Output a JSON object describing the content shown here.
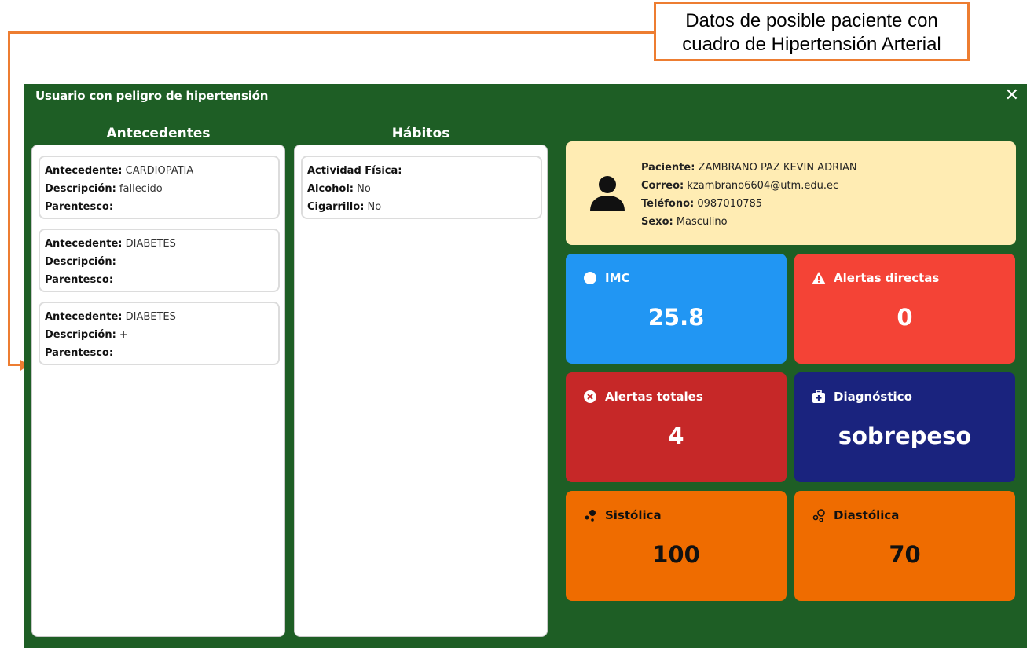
{
  "annotation": {
    "line1": "Datos de posible paciente con",
    "line2": "cuadro de Hipertensión Arterial"
  },
  "window": {
    "title": "Usuario con peligro de hipertensión",
    "close": "✕"
  },
  "antecedentes": {
    "heading": "Antecedentes",
    "field_labels": {
      "antecedente": "Antecedente:",
      "descripcion": "Descripción:",
      "parentesco": "Parentesco:"
    },
    "items": [
      {
        "antecedente": "CARDIOPATIA",
        "descripcion": "fallecido",
        "parentesco": ""
      },
      {
        "antecedente": "DIABETES",
        "descripcion": "",
        "parentesco": ""
      },
      {
        "antecedente": "DIABETES",
        "descripcion": "+",
        "parentesco": ""
      }
    ]
  },
  "habitos": {
    "heading": "Hábitos",
    "labels": {
      "actividad": "Actividad Física:",
      "alcohol": "Alcohol:",
      "cigarrillo": "Cigarrillo:"
    },
    "values": {
      "actividad": "",
      "alcohol": "No",
      "cigarrillo": "No"
    }
  },
  "paciente": {
    "labels": {
      "nombre": "Paciente:",
      "correo": "Correo:",
      "telefono": "Teléfono:",
      "sexo": "Sexo:"
    },
    "nombre": "ZAMBRANO PAZ KEVIN ADRIAN",
    "correo": "kzambrano6604@utm.edu.ec",
    "telefono": "0987010785",
    "sexo": "Masculino"
  },
  "stats": {
    "imc": {
      "label": "IMC",
      "value": "25.8",
      "color": "#2196f3"
    },
    "alertas_directas": {
      "label": "Alertas directas",
      "value": "0",
      "color": "#f44336"
    },
    "alertas_totales": {
      "label": "Alertas totales",
      "value": "4",
      "color": "#c62828"
    },
    "diagnostico": {
      "label": "Diagnóstico",
      "value": "sobrepeso",
      "color": "#1a237e"
    },
    "sistolica": {
      "label": "Sistólica",
      "value": "100",
      "color": "#ef6c00"
    },
    "diastolica": {
      "label": "Diastólica",
      "value": "70",
      "color": "#ef6c00"
    }
  },
  "colors": {
    "window_bg": "#1e5e25",
    "accent_annotation": "#ed7d31",
    "info_bg": "#ffecb3"
  }
}
